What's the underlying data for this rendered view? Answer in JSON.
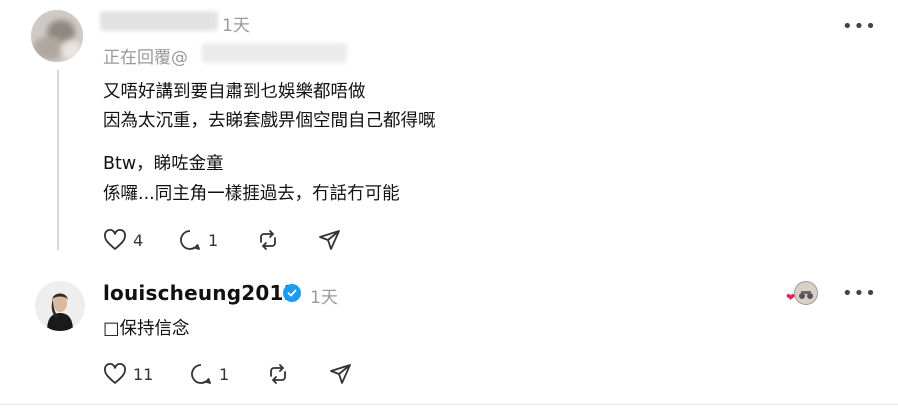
{
  "post1": {
    "time": "1天",
    "reply_prefix": "正在回覆@",
    "lines": [
      "又唔好講到要自肅到乜娛樂都唔做",
      "因為太沉重，去睇套戲畀個空間自己都得嘅",
      "Btw，睇咗金童",
      "係囉...同主角一樣捱過去，冇話冇可能"
    ],
    "likes": "4",
    "replies": "1"
  },
  "post2": {
    "username": "louischeung2013",
    "time": "1天",
    "text": "□保持信念",
    "likes": "11",
    "replies": "1"
  },
  "colors": {
    "verified": "#1d9bf0",
    "heart": "#e0245e"
  }
}
